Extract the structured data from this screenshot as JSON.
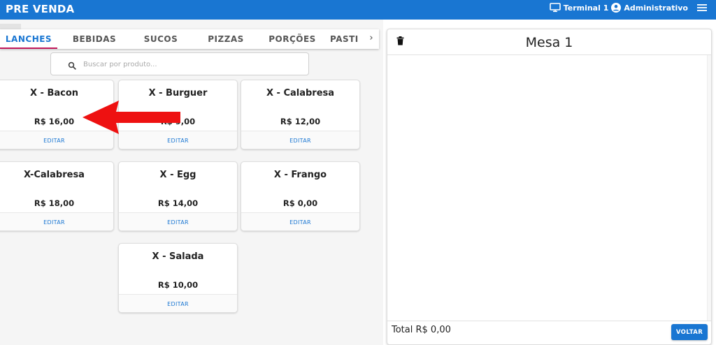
{
  "header": {
    "title": "PRE VENDA",
    "terminal": "Terminal 1",
    "user": "Administrativo",
    "colors": {
      "primary": "#1976d2",
      "tab_indicator": "#c2185b",
      "arrow": "#ee1111"
    }
  },
  "tabs": [
    "LANCHES",
    "BEBIDAS",
    "SUCOS",
    "PIZZAS",
    "PORÇÕES",
    "PASTI"
  ],
  "active_tab": "LANCHES",
  "search": {
    "placeholder": "Buscar por produto..."
  },
  "products": [
    {
      "name": "X - Bacon",
      "price": "R$ 16,00",
      "action": "EDITAR"
    },
    {
      "name": "X - Burguer",
      "price": "R$ 9,00",
      "action": "EDITAR"
    },
    {
      "name": "X - Calabresa",
      "price": "R$ 12,00",
      "action": "EDITAR"
    },
    {
      "name": "X-Calabresa",
      "price": "R$ 18,00",
      "action": "EDITAR"
    },
    {
      "name": "X - Egg",
      "price": "R$ 14,00",
      "action": "EDITAR"
    },
    {
      "name": "X - Frango",
      "price": "R$ 0,00",
      "action": "EDITAR"
    },
    {
      "name": "X - Salada",
      "price": "R$ 10,00",
      "action": "EDITAR"
    }
  ],
  "order": {
    "title": "Mesa 1",
    "total": "Total R$ 0,00",
    "back_label": "VOLTAR"
  }
}
